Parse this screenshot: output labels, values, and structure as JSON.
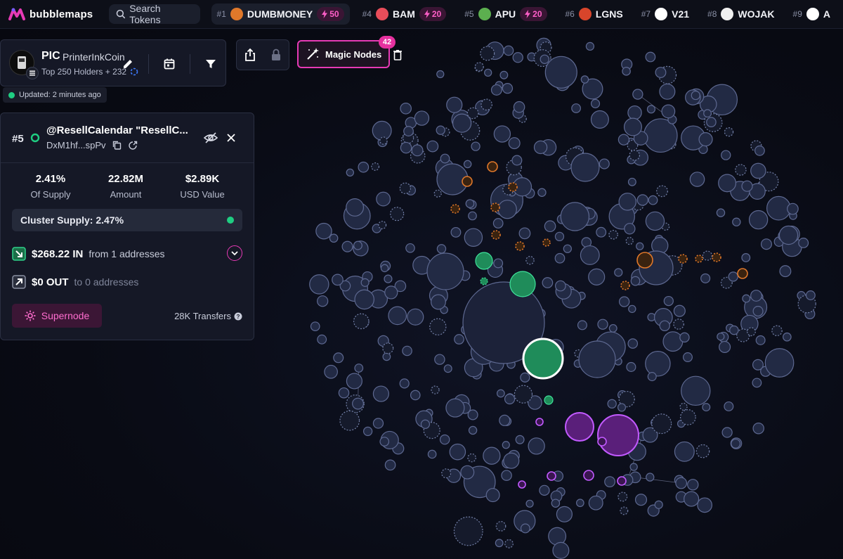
{
  "brand": {
    "name": "bubblemaps"
  },
  "search": {
    "label": "Search Tokens"
  },
  "trending": [
    {
      "rank": "#1",
      "name": "DUMBMONEY",
      "boost": "50",
      "logo_color": "#e0782a",
      "active": true
    },
    {
      "rank": "#4",
      "name": "BAM",
      "boost": "20",
      "logo_color": "#e84d5a",
      "active": false
    },
    {
      "rank": "#5",
      "name": "APU",
      "boost": "20",
      "logo_color": "#5caf4f",
      "active": false
    },
    {
      "rank": "#6",
      "name": "LGNS",
      "boost": "",
      "logo_color": "#d8452b",
      "active": false
    },
    {
      "rank": "#7",
      "name": "V21",
      "boost": "",
      "logo_color": "#ffffff",
      "active": false
    },
    {
      "rank": "#8",
      "name": "WOJAK",
      "boost": "",
      "logo_color": "#f0f0f0",
      "active": false
    },
    {
      "rank": "#9",
      "name": "A",
      "boost": "",
      "logo_color": "#ffffff",
      "active": false
    }
  ],
  "token": {
    "symbol": "PIC",
    "name": "PrinterInkCoin",
    "holders_label": "Top 250 Holders + 232",
    "updated": "Updated: 2 minutes ago"
  },
  "toolbar": {
    "magic_nodes_label": "Magic Nodes",
    "magic_nodes_count": "42"
  },
  "wallet": {
    "rank": "#5",
    "name": "@ResellCalendar \"ResellC...",
    "address": "DxM1hf...spPv",
    "stats": [
      {
        "value": "2.41%",
        "label": "Of Supply"
      },
      {
        "value": "22.82M",
        "label": "Amount"
      },
      {
        "value": "$2.89K",
        "label": "USD Value"
      }
    ],
    "cluster_supply": "Cluster Supply: 2.47%",
    "in_amount": "$268.22 IN",
    "in_from": "from 1 addresses",
    "out_amount": "$0 OUT",
    "out_to": "to 0 addresses",
    "supernode_label": "Supernode",
    "transfers": "28K Transfers"
  },
  "colors": {
    "accent_pink": "#e63ab5",
    "node_default": "#2b3350",
    "node_green": "#1f8c5a",
    "node_orange": "#e0782a",
    "node_purple": "#a23ad8"
  }
}
